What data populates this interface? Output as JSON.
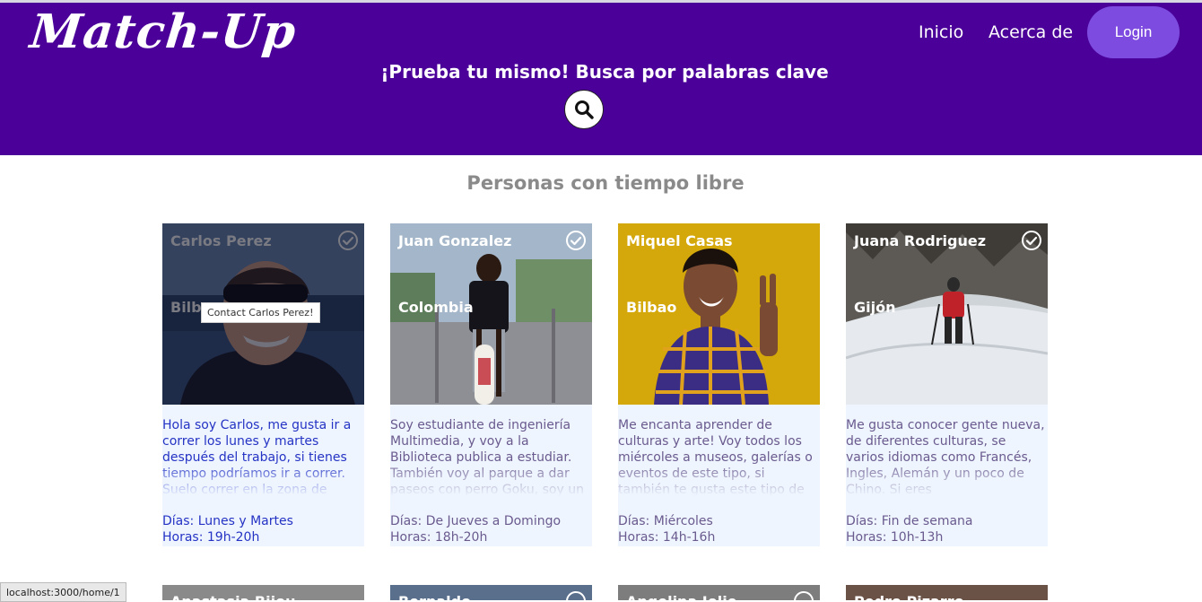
{
  "header": {
    "logo": "Match-Up",
    "nav": {
      "home": "Inicio",
      "about": "Acerca de"
    },
    "login_label": "Login",
    "hero_title": "¡Prueba tu mismo! Busca por palabras clave",
    "search_icon": "search-icon"
  },
  "section": {
    "title": "Personas con tiempo libre"
  },
  "cards": [
    {
      "name": "Carlos Perez",
      "city": "Bilb",
      "description": "Hola soy Carlos, me gusta ir a correr los lunes y martes después del trabajo, si tienes tiempo podríamos ir a correr. Suelo correr en la zona de",
      "days": "Días: Lunes y Martes",
      "hours": "Horas: 19h-20h",
      "tooltip": "Contact Carlos Perez!",
      "accent": "#2533c4"
    },
    {
      "name": "Juan Gonzalez",
      "city": "Colombia",
      "description": "Soy estudiante de ingeniería Multimedia, y voy a la Biblioteca publica a estudiar. También voy al parque a dar paseos con perro Goku, soy un",
      "days": "Días: De Jueves a Domingo",
      "hours": "Horas: 18h-20h"
    },
    {
      "name": "Miquel Casas",
      "city": "Bilbao",
      "description": "Me encanta aprender de culturas y arte! Voy todos los miércoles a museos, galerías o eventos de este tipo, si también te gusta este tipo de",
      "days": "Días: Miércoles",
      "hours": "Horas: 14h-16h"
    },
    {
      "name": "Juana Rodriguez",
      "city": "Gijón",
      "description": "Me gusta conocer gente nueva, de diferentes culturas, se varios idiomas como Francés, Ingles, Alemán y un poco de Chino. Si eres",
      "days": "Días: Fin de semana",
      "hours": "Horas: 10h-13h"
    }
  ],
  "row2_names": [
    "Anastasia Bijou",
    "Bernaldo",
    "Angelina Jolie",
    "Pedro Pizarro"
  ],
  "status_url": "localhost:3000/home/1",
  "colors": {
    "header_bg": "#4a0099",
    "login_bg": "#7d4bdf",
    "card_bg": "#eef5ff"
  }
}
